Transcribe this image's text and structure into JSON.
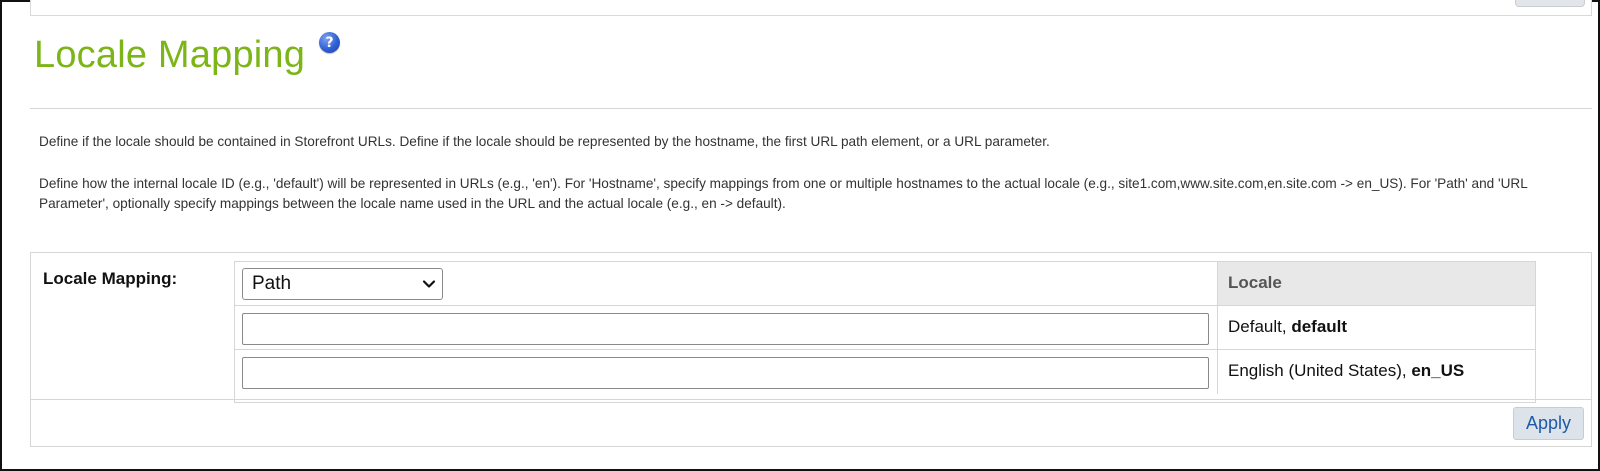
{
  "header": {
    "title": "Locale Mapping",
    "help_icon": "question-circle-icon",
    "help_symbol": "?"
  },
  "description": {
    "paragraph1": "Define if the locale should be contained in Storefront URLs. Define if the locale should be represented by the hostname, the first URL path element, or a URL parameter.",
    "paragraph2": "Define how the internal locale ID (e.g., 'default') will be represented in URLs (e.g., 'en'). For 'Hostname', specify mappings from one or multiple hostnames to the actual locale (e.g., site1.com,www.site.com,en.site.com -> en_US). For 'Path' and 'URL Parameter', optionally specify mappings between the locale name used in the URL and the actual locale (e.g., en -> default)."
  },
  "mapping": {
    "label": "Locale Mapping:",
    "select_value": "Path",
    "select_icon": "chevron-down-icon",
    "column_header": "Locale",
    "rows": [
      {
        "input_value": "",
        "locale_name": "Default, ",
        "locale_id": "default"
      },
      {
        "input_value": "",
        "locale_name": "English (United States), ",
        "locale_id": "en_US"
      }
    ],
    "apply_label": "Apply"
  },
  "colors": {
    "title": "#7cb518",
    "help_icon": "#2f5fd6",
    "link": "#1f5aa8",
    "header_bg": "#e8e8e8",
    "border": "#d6d6d6"
  }
}
